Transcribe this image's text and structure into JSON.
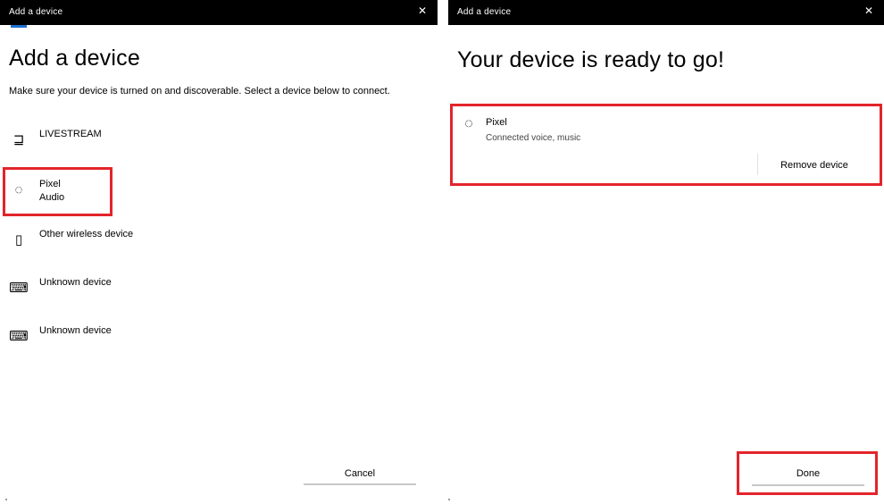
{
  "left": {
    "window_title": "Add a device",
    "close_glyph": "✕",
    "heading": "Add a device",
    "description": "Make sure your device is turned on and discoverable. Select a device below to connect.",
    "devices": [
      {
        "name": "LIVESTREAM",
        "sub": "",
        "icon": "monitor-icon",
        "glyph": "⊒"
      },
      {
        "name": "Pixel",
        "sub": "Audio",
        "icon": "headphones-icon",
        "glyph": "◌"
      },
      {
        "name": "Other wireless device",
        "sub": "",
        "icon": "generic-device-icon",
        "glyph": "▯"
      },
      {
        "name": "Unknown device",
        "sub": "",
        "icon": "keyboard-icon",
        "glyph": "⌨"
      },
      {
        "name": "Unknown device",
        "sub": "",
        "icon": "keyboard-icon",
        "glyph": "⌨"
      }
    ],
    "cancel_label": "Cancel"
  },
  "right": {
    "window_title": "Add a device",
    "close_glyph": "✕",
    "heading": "Your device is ready to go!",
    "device_name": "Pixel",
    "device_status": "Connected voice, music",
    "device_glyph": "◌",
    "remove_label": "Remove device",
    "done_label": "Done"
  },
  "colors": {
    "highlight": "#e3242b",
    "titlebar": "#000000",
    "accent": "#1f6fd1",
    "button_underline": "#c8c8c8"
  }
}
